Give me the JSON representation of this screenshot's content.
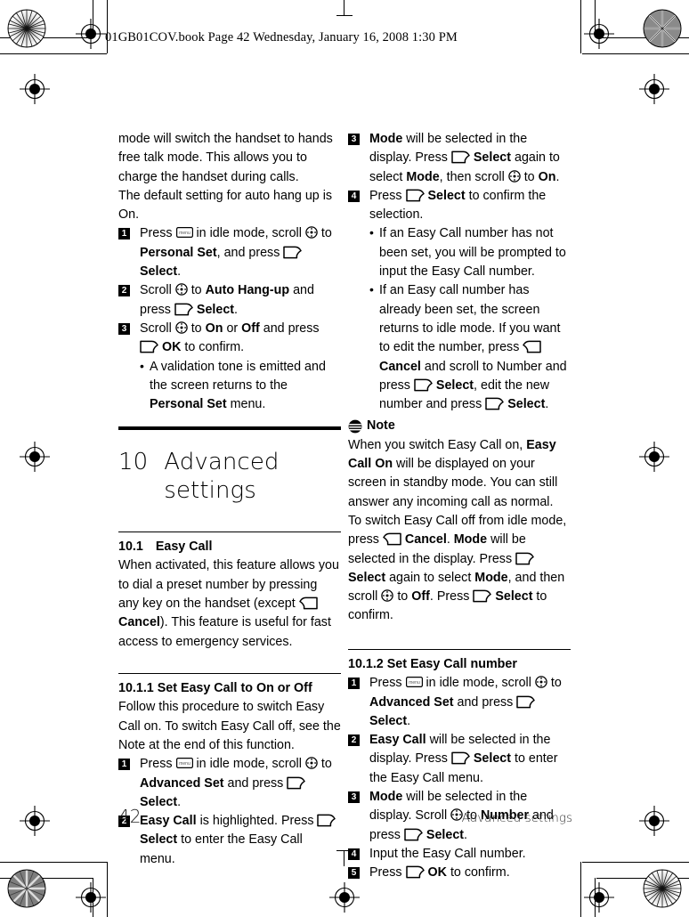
{
  "document": {
    "file_header": "01GB01COV.book  Page 42  Wednesday, January 16, 2008  1:30 PM",
    "page_number": "42",
    "footer_label": "Advanced settings"
  },
  "icons": {
    "menu": "menu-key-icon",
    "menu_label": "menu",
    "select": "select-softkey-icon",
    "cancel": "cancel-softkey-icon",
    "nav": "navigation-scroll-icon",
    "note": "note-icon"
  },
  "left_column": {
    "continued_paragraph_1": "mode will switch the handset to hands free talk mode. This allows you to charge the handset during calls.",
    "continued_paragraph_2": "The default setting for auto hang up is On.",
    "steps": [
      {
        "num": "1",
        "parts": [
          {
            "t": "Press ",
            "style": "normal"
          },
          {
            "t": "menu-icon",
            "style": "icon"
          },
          {
            "t": " in idle mode, scroll ",
            "style": "normal"
          },
          {
            "t": "nav-icon",
            "style": "icon"
          },
          {
            "t": " to ",
            "style": "normal"
          },
          {
            "t": "Personal Set",
            "style": "bold"
          },
          {
            "t": ", and press ",
            "style": "normal"
          },
          {
            "t": "select-icon",
            "style": "icon"
          },
          {
            "t": " ",
            "style": "normal"
          },
          {
            "t": "Select",
            "style": "bold"
          },
          {
            "t": ".",
            "style": "normal"
          }
        ]
      },
      {
        "num": "2",
        "parts": [
          {
            "t": "Scroll ",
            "style": "normal"
          },
          {
            "t": "nav-icon",
            "style": "icon"
          },
          {
            "t": " to ",
            "style": "normal"
          },
          {
            "t": "Auto Hang-up",
            "style": "bold"
          },
          {
            "t": " and press ",
            "style": "normal"
          },
          {
            "t": "select-icon",
            "style": "icon"
          },
          {
            "t": " ",
            "style": "normal"
          },
          {
            "t": "Select",
            "style": "bold"
          },
          {
            "t": ".",
            "style": "normal"
          }
        ]
      },
      {
        "num": "3",
        "parts": [
          {
            "t": "Scroll ",
            "style": "normal"
          },
          {
            "t": "nav-icon",
            "style": "icon"
          },
          {
            "t": " to ",
            "style": "normal"
          },
          {
            "t": "On",
            "style": "bold"
          },
          {
            "t": " or ",
            "style": "normal"
          },
          {
            "t": "Off",
            "style": "bold"
          },
          {
            "t": " and press ",
            "style": "normal"
          },
          {
            "t": "select-icon",
            "style": "icon"
          },
          {
            "t": " ",
            "style": "normal"
          },
          {
            "t": "OK",
            "style": "bold"
          },
          {
            "t": " to confirm.",
            "style": "normal"
          }
        ]
      }
    ],
    "bullet_after_step3": [
      {
        "t": "A validation tone is emitted and the screen returns to the ",
        "style": "normal"
      },
      {
        "t": "Personal Set",
        "style": "bold"
      },
      {
        "t": " menu.",
        "style": "normal"
      }
    ],
    "chapter": {
      "number": "10",
      "title": "Advanced settings"
    },
    "section_10_1": {
      "number": "10.1",
      "title": "Easy Call",
      "body_parts": [
        {
          "t": "When activated, this feature allows you to dial a preset number by pressing any key on the handset (except ",
          "style": "normal"
        },
        {
          "t": "cancel-icon",
          "style": "icon"
        },
        {
          "t": " ",
          "style": "normal"
        },
        {
          "t": "Cancel",
          "style": "bold"
        },
        {
          "t": "). This feature is useful for fast access to emergency services.",
          "style": "normal"
        }
      ]
    },
    "section_10_1_1": {
      "title": "10.1.1 Set Easy Call to On or Off",
      "intro": "Follow this procedure to switch Easy Call on. To switch Easy Call off, see the Note at the end of this function.",
      "steps": [
        {
          "num": "1",
          "parts": [
            {
              "t": "Press ",
              "style": "normal"
            },
            {
              "t": "menu-icon",
              "style": "icon"
            },
            {
              "t": " in idle mode, scroll ",
              "style": "normal"
            },
            {
              "t": "nav-icon",
              "style": "icon"
            },
            {
              "t": " to ",
              "style": "normal"
            },
            {
              "t": "Advanced Set",
              "style": "bold"
            },
            {
              "t": " and press ",
              "style": "normal"
            },
            {
              "t": "select-icon",
              "style": "icon"
            },
            {
              "t": " ",
              "style": "normal"
            },
            {
              "t": "Select",
              "style": "bold"
            },
            {
              "t": ".",
              "style": "normal"
            }
          ]
        },
        {
          "num": "2",
          "parts": [
            {
              "t": "Easy Call",
              "style": "bold"
            },
            {
              "t": " is highlighted. Press ",
              "style": "normal"
            },
            {
              "t": "select-icon",
              "style": "icon"
            },
            {
              "t": " ",
              "style": "normal"
            },
            {
              "t": "Select",
              "style": "bold"
            },
            {
              "t": " to enter the Easy Call menu.",
              "style": "normal"
            }
          ]
        }
      ]
    }
  },
  "right_column": {
    "steps_continued": [
      {
        "num": "3",
        "parts": [
          {
            "t": "Mode",
            "style": "bold"
          },
          {
            "t": " will be selected in the display. Press ",
            "style": "normal"
          },
          {
            "t": "select-icon",
            "style": "icon"
          },
          {
            "t": " ",
            "style": "normal"
          },
          {
            "t": "Select",
            "style": "bold"
          },
          {
            "t": " again to select ",
            "style": "normal"
          },
          {
            "t": "Mode",
            "style": "bold"
          },
          {
            "t": ", then scroll ",
            "style": "normal"
          },
          {
            "t": "nav-icon",
            "style": "icon"
          },
          {
            "t": " to ",
            "style": "normal"
          },
          {
            "t": "On",
            "style": "bold"
          },
          {
            "t": ".",
            "style": "normal"
          }
        ]
      },
      {
        "num": "4",
        "parts": [
          {
            "t": "Press ",
            "style": "normal"
          },
          {
            "t": "select-icon",
            "style": "icon"
          },
          {
            "t": " ",
            "style": "normal"
          },
          {
            "t": "Select",
            "style": "bold"
          },
          {
            "t": " to confirm the selection.",
            "style": "normal"
          }
        ]
      }
    ],
    "bullets": [
      [
        {
          "t": "If an Easy Call number has not been set, you will be prompted to input the Easy Call number.",
          "style": "normal"
        }
      ],
      [
        {
          "t": "If an Easy call number has already been set, the screen returns to idle mode. If you want to edit the number, press ",
          "style": "normal"
        },
        {
          "t": "cancel-icon",
          "style": "icon"
        },
        {
          "t": " ",
          "style": "normal"
        },
        {
          "t": "Cancel",
          "style": "bold"
        },
        {
          "t": " and scroll to Number and press ",
          "style": "normal"
        },
        {
          "t": "select-icon",
          "style": "icon"
        },
        {
          "t": " ",
          "style": "normal"
        },
        {
          "t": "Select",
          "style": "bold"
        },
        {
          "t": ", edit the new number and press ",
          "style": "normal"
        },
        {
          "t": "select-icon",
          "style": "icon"
        },
        {
          "t": " ",
          "style": "normal"
        },
        {
          "t": "Select",
          "style": "bold"
        },
        {
          "t": ".",
          "style": "normal"
        }
      ]
    ],
    "note": {
      "label": "Note",
      "body_parts": [
        {
          "t": "When you switch Easy Call on, ",
          "style": "normal"
        },
        {
          "t": "Easy Call On",
          "style": "bold"
        },
        {
          "t": " will be displayed on your screen in standby mode. You can still answer any incoming call as normal.",
          "style": "normal"
        }
      ],
      "body_parts_2": [
        {
          "t": "To switch Easy Call off from idle mode, press ",
          "style": "normal"
        },
        {
          "t": "cancel-icon",
          "style": "icon"
        },
        {
          "t": " ",
          "style": "normal"
        },
        {
          "t": "Cancel",
          "style": "bold"
        },
        {
          "t": ". ",
          "style": "normal"
        },
        {
          "t": "Mode",
          "style": "bold"
        },
        {
          "t": " will be selected in the display. Press ",
          "style": "normal"
        },
        {
          "t": "select-icon",
          "style": "icon"
        },
        {
          "t": " ",
          "style": "normal"
        },
        {
          "t": "Select",
          "style": "bold"
        },
        {
          "t": " again to select ",
          "style": "normal"
        },
        {
          "t": "Mode",
          "style": "bold"
        },
        {
          "t": ", and then scroll ",
          "style": "normal"
        },
        {
          "t": "nav-icon",
          "style": "icon"
        },
        {
          "t": " to ",
          "style": "normal"
        },
        {
          "t": "Off",
          "style": "bold"
        },
        {
          "t": ". Press ",
          "style": "normal"
        },
        {
          "t": "select-icon",
          "style": "icon"
        },
        {
          "t": " ",
          "style": "normal"
        },
        {
          "t": "Select",
          "style": "bold"
        },
        {
          "t": " to confirm.",
          "style": "normal"
        }
      ]
    },
    "section_10_1_2": {
      "title": "10.1.2 Set Easy Call number",
      "steps": [
        {
          "num": "1",
          "parts": [
            {
              "t": "Press ",
              "style": "normal"
            },
            {
              "t": "menu-icon",
              "style": "icon"
            },
            {
              "t": " in idle mode, scroll ",
              "style": "normal"
            },
            {
              "t": "nav-icon",
              "style": "icon"
            },
            {
              "t": " to ",
              "style": "normal"
            },
            {
              "t": "Advanced Set",
              "style": "bold"
            },
            {
              "t": " and press ",
              "style": "normal"
            },
            {
              "t": "select-icon",
              "style": "icon"
            },
            {
              "t": " ",
              "style": "normal"
            },
            {
              "t": "Select",
              "style": "bold"
            },
            {
              "t": ".",
              "style": "normal"
            }
          ]
        },
        {
          "num": "2",
          "parts": [
            {
              "t": "Easy Call",
              "style": "bold"
            },
            {
              "t": " will be selected in the display. Press ",
              "style": "normal"
            },
            {
              "t": "select-icon",
              "style": "icon"
            },
            {
              "t": " ",
              "style": "normal"
            },
            {
              "t": "Select",
              "style": "bold"
            },
            {
              "t": " to enter the Easy Call menu.",
              "style": "normal"
            }
          ]
        },
        {
          "num": "3",
          "parts": [
            {
              "t": "Mode",
              "style": "bold"
            },
            {
              "t": " will be selected in the display. Scroll ",
              "style": "normal"
            },
            {
              "t": "nav-icon",
              "style": "icon"
            },
            {
              "t": " to ",
              "style": "normal"
            },
            {
              "t": "Number",
              "style": "bold"
            },
            {
              "t": " and press ",
              "style": "normal"
            },
            {
              "t": "select-icon",
              "style": "icon"
            },
            {
              "t": " ",
              "style": "normal"
            },
            {
              "t": "Select",
              "style": "bold"
            },
            {
              "t": ".",
              "style": "normal"
            }
          ]
        },
        {
          "num": "4",
          "parts": [
            {
              "t": "Input the Easy Call number.",
              "style": "normal"
            }
          ]
        },
        {
          "num": "5",
          "parts": [
            {
              "t": "Press ",
              "style": "normal"
            },
            {
              "t": "select-icon",
              "style": "icon"
            },
            {
              "t": " ",
              "style": "normal"
            },
            {
              "t": "OK",
              "style": "bold"
            },
            {
              "t": " to confirm.",
              "style": "normal"
            }
          ]
        }
      ]
    }
  }
}
